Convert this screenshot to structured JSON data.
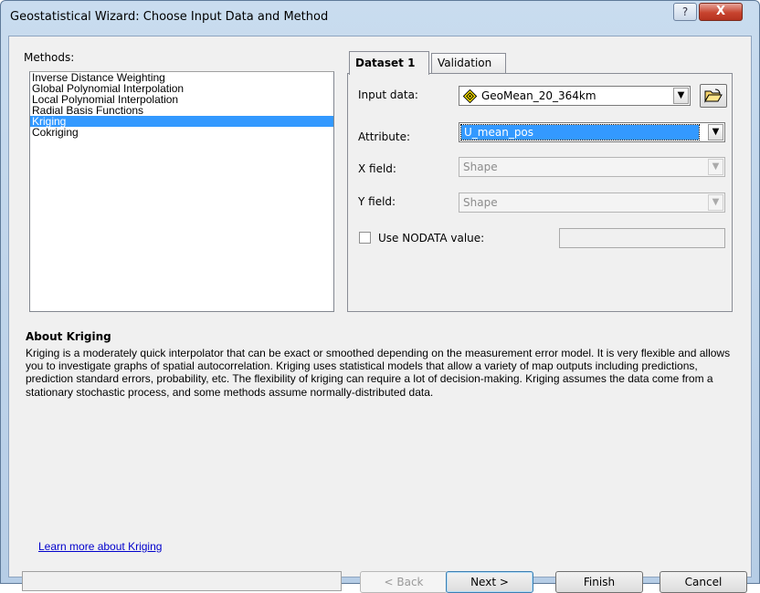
{
  "window": {
    "title": "Geostatistical Wizard: Choose Input Data and Method",
    "help_glyph": "?",
    "close_glyph": "X"
  },
  "methods": {
    "label": "Methods:",
    "items": [
      {
        "label": "Inverse Distance Weighting",
        "selected": false
      },
      {
        "label": "Global Polynomial Interpolation",
        "selected": false
      },
      {
        "label": "Local Polynomial Interpolation",
        "selected": false
      },
      {
        "label": "Radial Basis Functions",
        "selected": false
      },
      {
        "label": "Kriging",
        "selected": true
      },
      {
        "label": "Cokriging",
        "selected": false
      }
    ]
  },
  "tabs": {
    "dataset": "Dataset 1",
    "validation": "Validation"
  },
  "dataset": {
    "input_label": "Input data:",
    "input_value": "GeoMean_20_364km",
    "attribute_label": "Attribute:",
    "attribute_value": "U_mean_pos",
    "xfield_label": "X field:",
    "xfield_value": "Shape",
    "yfield_label": "Y field:",
    "yfield_value": "Shape",
    "nodata_label": "Use NODATA value:",
    "nodata_value": ""
  },
  "about": {
    "title": "About Kriging",
    "text": "Kriging is a moderately quick interpolator that can be exact or smoothed depending on the measurement error model. It is very flexible and allows you to investigate graphs of spatial autocorrelation. Kriging uses statistical models that allow a variety of map outputs including predictions, prediction standard errors, probability, etc. The flexibility of kriging can require a lot of decision-making. Kriging assumes the data come from a stationary stochastic process, and some methods assume normally-distributed data.",
    "link": "Learn more about Kriging"
  },
  "buttons": {
    "back": "< Back",
    "next": "Next >",
    "finish": "Finish",
    "cancel": "Cancel"
  },
  "colors": {
    "selection": "#3399ff",
    "link": "#0000cc",
    "icon_yellow": "#ffe600"
  },
  "icons": {
    "input_layer": "diamond-point-layer-icon",
    "browse": "open-folder-icon",
    "dropdown": "chevron-down-icon"
  }
}
